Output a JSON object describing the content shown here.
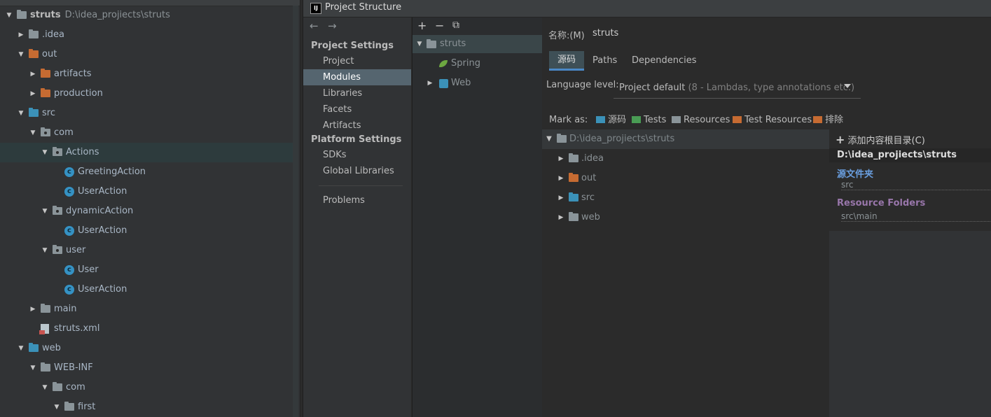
{
  "project_panel": {
    "tree": [
      {
        "label": "struts",
        "path": "D:\\idea_projiects\\struts",
        "bold": true,
        "depth": 0,
        "arrow": "down",
        "icon": "module-folder-icon"
      },
      {
        "label": ".idea",
        "depth": 1,
        "arrow": "right",
        "icon": "folder-icon"
      },
      {
        "label": "out",
        "depth": 1,
        "arrow": "down",
        "icon": "excluded-folder-icon"
      },
      {
        "label": "artifacts",
        "depth": 2,
        "arrow": "right",
        "icon": "excluded-folder-icon"
      },
      {
        "label": "production",
        "depth": 2,
        "arrow": "right",
        "icon": "excluded-folder-icon"
      },
      {
        "label": "src",
        "depth": 1,
        "arrow": "down",
        "icon": "source-folder-icon"
      },
      {
        "label": "com",
        "depth": 2,
        "arrow": "down",
        "icon": "package-icon"
      },
      {
        "label": "Actions",
        "depth": 3,
        "arrow": "down",
        "icon": "package-icon",
        "selected": true
      },
      {
        "label": "GreetingAction",
        "depth": 4,
        "arrow": "",
        "icon": "class-icon"
      },
      {
        "label": "UserAction",
        "depth": 4,
        "arrow": "",
        "icon": "class-icon"
      },
      {
        "label": "dynamicAction",
        "depth": 3,
        "arrow": "down",
        "icon": "package-icon"
      },
      {
        "label": "UserAction",
        "depth": 4,
        "arrow": "",
        "icon": "class-icon"
      },
      {
        "label": "user",
        "depth": 3,
        "arrow": "down",
        "icon": "package-icon"
      },
      {
        "label": "User",
        "depth": 4,
        "arrow": "",
        "icon": "class-icon"
      },
      {
        "label": "UserAction",
        "depth": 4,
        "arrow": "",
        "icon": "class-icon"
      },
      {
        "label": "main",
        "depth": 2,
        "arrow": "right",
        "icon": "resource-folder-icon"
      },
      {
        "label": "struts.xml",
        "depth": 2,
        "arrow": "",
        "icon": "xml-file-icon"
      },
      {
        "label": "web",
        "depth": 1,
        "arrow": "down",
        "icon": "web-folder-icon"
      },
      {
        "label": "WEB-INF",
        "depth": 2,
        "arrow": "down",
        "icon": "folder-icon"
      },
      {
        "label": "com",
        "depth": 3,
        "arrow": "down",
        "icon": "folder-icon"
      },
      {
        "label": "first",
        "depth": 4,
        "arrow": "down",
        "icon": "folder-icon"
      }
    ]
  },
  "dialog": {
    "title": "Project Structure",
    "app_icon": "IJ",
    "nav": {
      "back_icon": "←",
      "forward_icon": "→",
      "section_project": "Project Settings",
      "project_items": [
        "Project",
        "Modules",
        "Libraries",
        "Facets",
        "Artifacts"
      ],
      "section_platform": "Platform Settings",
      "platform_items": [
        "SDKs",
        "Global Libraries"
      ],
      "problems": "Problems",
      "selected": "Modules"
    },
    "modules": {
      "toolbar": {
        "add": "+",
        "remove": "−",
        "copy": "⧉"
      },
      "tree": [
        {
          "label": "struts",
          "arrow": "▼"
        },
        {
          "label": "Spring",
          "arrow": ""
        },
        {
          "label": "Web",
          "arrow": "▶"
        }
      ]
    },
    "content": {
      "name_label": "名称:(M)",
      "name_value": "struts",
      "tabs": [
        "源码",
        "Paths",
        "Dependencies"
      ],
      "language_level_label": "Language level:",
      "language_level_value": "Project default",
      "language_level_hint": "(8 - Lambdas, type annotations etc.)",
      "mark_as_label": "Mark as:",
      "mark_as": [
        {
          "label": "源码",
          "color": "#3b91b8"
        },
        {
          "label": "Tests",
          "color": "#499c54"
        },
        {
          "label": "Resources",
          "color": "#8a9499"
        },
        {
          "label": "Test Resources",
          "color": "#c66b32"
        },
        {
          "label": "排除",
          "color": "#c66b32"
        }
      ],
      "roots_tree": [
        {
          "label": "D:\\idea_projiects\\struts",
          "arrow": "▼"
        },
        {
          "label": ".idea",
          "arrow": "▶"
        },
        {
          "label": "out",
          "arrow": "▶"
        },
        {
          "label": "src",
          "arrow": "▶"
        },
        {
          "label": "web",
          "arrow": "▶"
        }
      ],
      "root_pane": {
        "add_root": "添加内容根目录(C)",
        "root_path": "D:\\idea_projiects\\struts",
        "source_folders_title": "源文件夹",
        "source_folders": [
          "src"
        ],
        "resource_folders_title": "Resource Folders",
        "resource_folders": [
          "src\\main"
        ]
      }
    }
  },
  "colors": {
    "source_title": "#6a9fe0",
    "resource_title": "#9876aa",
    "selection": "#55656f"
  }
}
